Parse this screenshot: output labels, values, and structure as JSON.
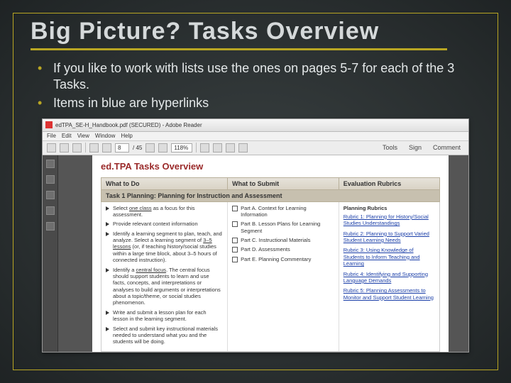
{
  "slide": {
    "title": "Big Picture? Tasks Overview",
    "bullets": [
      "If you like to work with lists use the ones on pages 5-7 for each of the 3 Tasks.",
      "Items in blue are hyperlinks"
    ]
  },
  "reader": {
    "window_title": "edTPA_SE-H_Handbook.pdf (SECURED) - Adobe Reader",
    "menu": [
      "File",
      "Edit",
      "View",
      "Window",
      "Help"
    ],
    "toolbar": {
      "page_current": "8",
      "page_total": "/ 45",
      "zoom": "118%"
    },
    "right_tabs": [
      "Tools",
      "Sign",
      "Comment"
    ]
  },
  "document": {
    "heading": "ed.TPA Tasks Overview",
    "columns": [
      "What to Do",
      "What to Submit",
      "Evaluation Rubrics"
    ],
    "task_bar": "Task 1 Planning: Planning for Instruction and Assessment",
    "col1_items": [
      {
        "pre": "Select ",
        "u": "one class",
        "post": " as a focus for this assessment."
      },
      {
        "pre": "Provide relevant context information",
        "u": "",
        "post": ""
      },
      {
        "pre": "Identify a learning segment to plan, teach, and analyze. Select a learning segment of ",
        "u": "3–5 lessons",
        "post": " (or, if teaching history/social studies within a large time block, about 3–5 hours of connected instruction)."
      },
      {
        "pre": "Identify a ",
        "u": "central focus",
        "post": ". The central focus should support students to learn and use facts, concepts, and interpretations or analyses to build arguments or interpretations about a topic/theme, or social studies phenomenon."
      },
      {
        "pre": "Write and submit a lesson plan for each lesson in the learning segment.",
        "u": "",
        "post": ""
      },
      {
        "pre": "Select and submit key instructional materials needed to understand what you and the students will be doing.",
        "u": "",
        "post": ""
      }
    ],
    "col2_items": [
      "Part A. Context for Learning Information",
      "Part B. Lesson Plans for Learning Segment",
      "Part C. Instructional Materials",
      "Part D. Assessments",
      "Part E. Planning Commentary"
    ],
    "col3_heading": "Planning Rubrics",
    "col3_links": [
      "Rubric 1: Planning for History/Social Studies Understandings",
      "Rubric 2: Planning to Support Varied Student Learning Needs",
      "Rubric 3: Using Knowledge of Students to Inform Teaching and Learning",
      "Rubric 4: Identifying and Supporting Language Demands",
      "Rubric 5: Planning Assessments to Monitor and Support Student Learning"
    ]
  }
}
